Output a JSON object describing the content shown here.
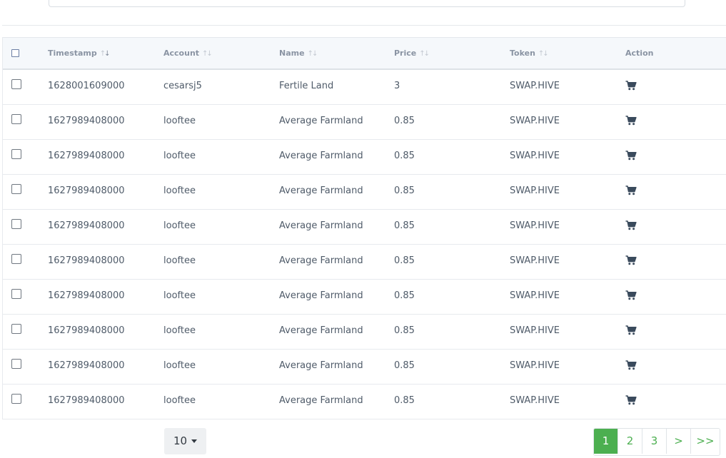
{
  "table": {
    "columns": [
      {
        "label": "Timestamp",
        "sort": "desc"
      },
      {
        "label": "Account",
        "sort": "none"
      },
      {
        "label": "Name",
        "sort": "none"
      },
      {
        "label": "Price",
        "sort": "none"
      },
      {
        "label": "Token",
        "sort": "none"
      },
      {
        "label": "Action",
        "sort": ""
      }
    ],
    "rows": [
      {
        "timestamp": "1628001609000",
        "account": "cesarsj5",
        "name": "Fertile Land",
        "price": "3",
        "token": "SWAP.HIVE",
        "action_icon": "cart-icon"
      },
      {
        "timestamp": "1627989408000",
        "account": "looftee",
        "name": "Average Farmland",
        "price": "0.85",
        "token": "SWAP.HIVE",
        "action_icon": "cart-icon"
      },
      {
        "timestamp": "1627989408000",
        "account": "looftee",
        "name": "Average Farmland",
        "price": "0.85",
        "token": "SWAP.HIVE",
        "action_icon": "cart-icon"
      },
      {
        "timestamp": "1627989408000",
        "account": "looftee",
        "name": "Average Farmland",
        "price": "0.85",
        "token": "SWAP.HIVE",
        "action_icon": "cart-icon"
      },
      {
        "timestamp": "1627989408000",
        "account": "looftee",
        "name": "Average Farmland",
        "price": "0.85",
        "token": "SWAP.HIVE",
        "action_icon": "cart-icon"
      },
      {
        "timestamp": "1627989408000",
        "account": "looftee",
        "name": "Average Farmland",
        "price": "0.85",
        "token": "SWAP.HIVE",
        "action_icon": "cart-icon"
      },
      {
        "timestamp": "1627989408000",
        "account": "looftee",
        "name": "Average Farmland",
        "price": "0.85",
        "token": "SWAP.HIVE",
        "action_icon": "cart-icon"
      },
      {
        "timestamp": "1627989408000",
        "account": "looftee",
        "name": "Average Farmland",
        "price": "0.85",
        "token": "SWAP.HIVE",
        "action_icon": "cart-icon"
      },
      {
        "timestamp": "1627989408000",
        "account": "looftee",
        "name": "Average Farmland",
        "price": "0.85",
        "token": "SWAP.HIVE",
        "action_icon": "cart-icon"
      },
      {
        "timestamp": "1627989408000",
        "account": "looftee",
        "name": "Average Farmland",
        "price": "0.85",
        "token": "SWAP.HIVE",
        "action_icon": "cart-icon"
      }
    ]
  },
  "footer": {
    "per_page": "10",
    "pagination": [
      "1",
      "2",
      "3",
      ">",
      ">>"
    ],
    "active_page": "1"
  },
  "colors": {
    "accent": "#4caf50",
    "header_bg": "#f5f8fb",
    "text": "#4f5b69",
    "icon": "#3a4a5c"
  }
}
